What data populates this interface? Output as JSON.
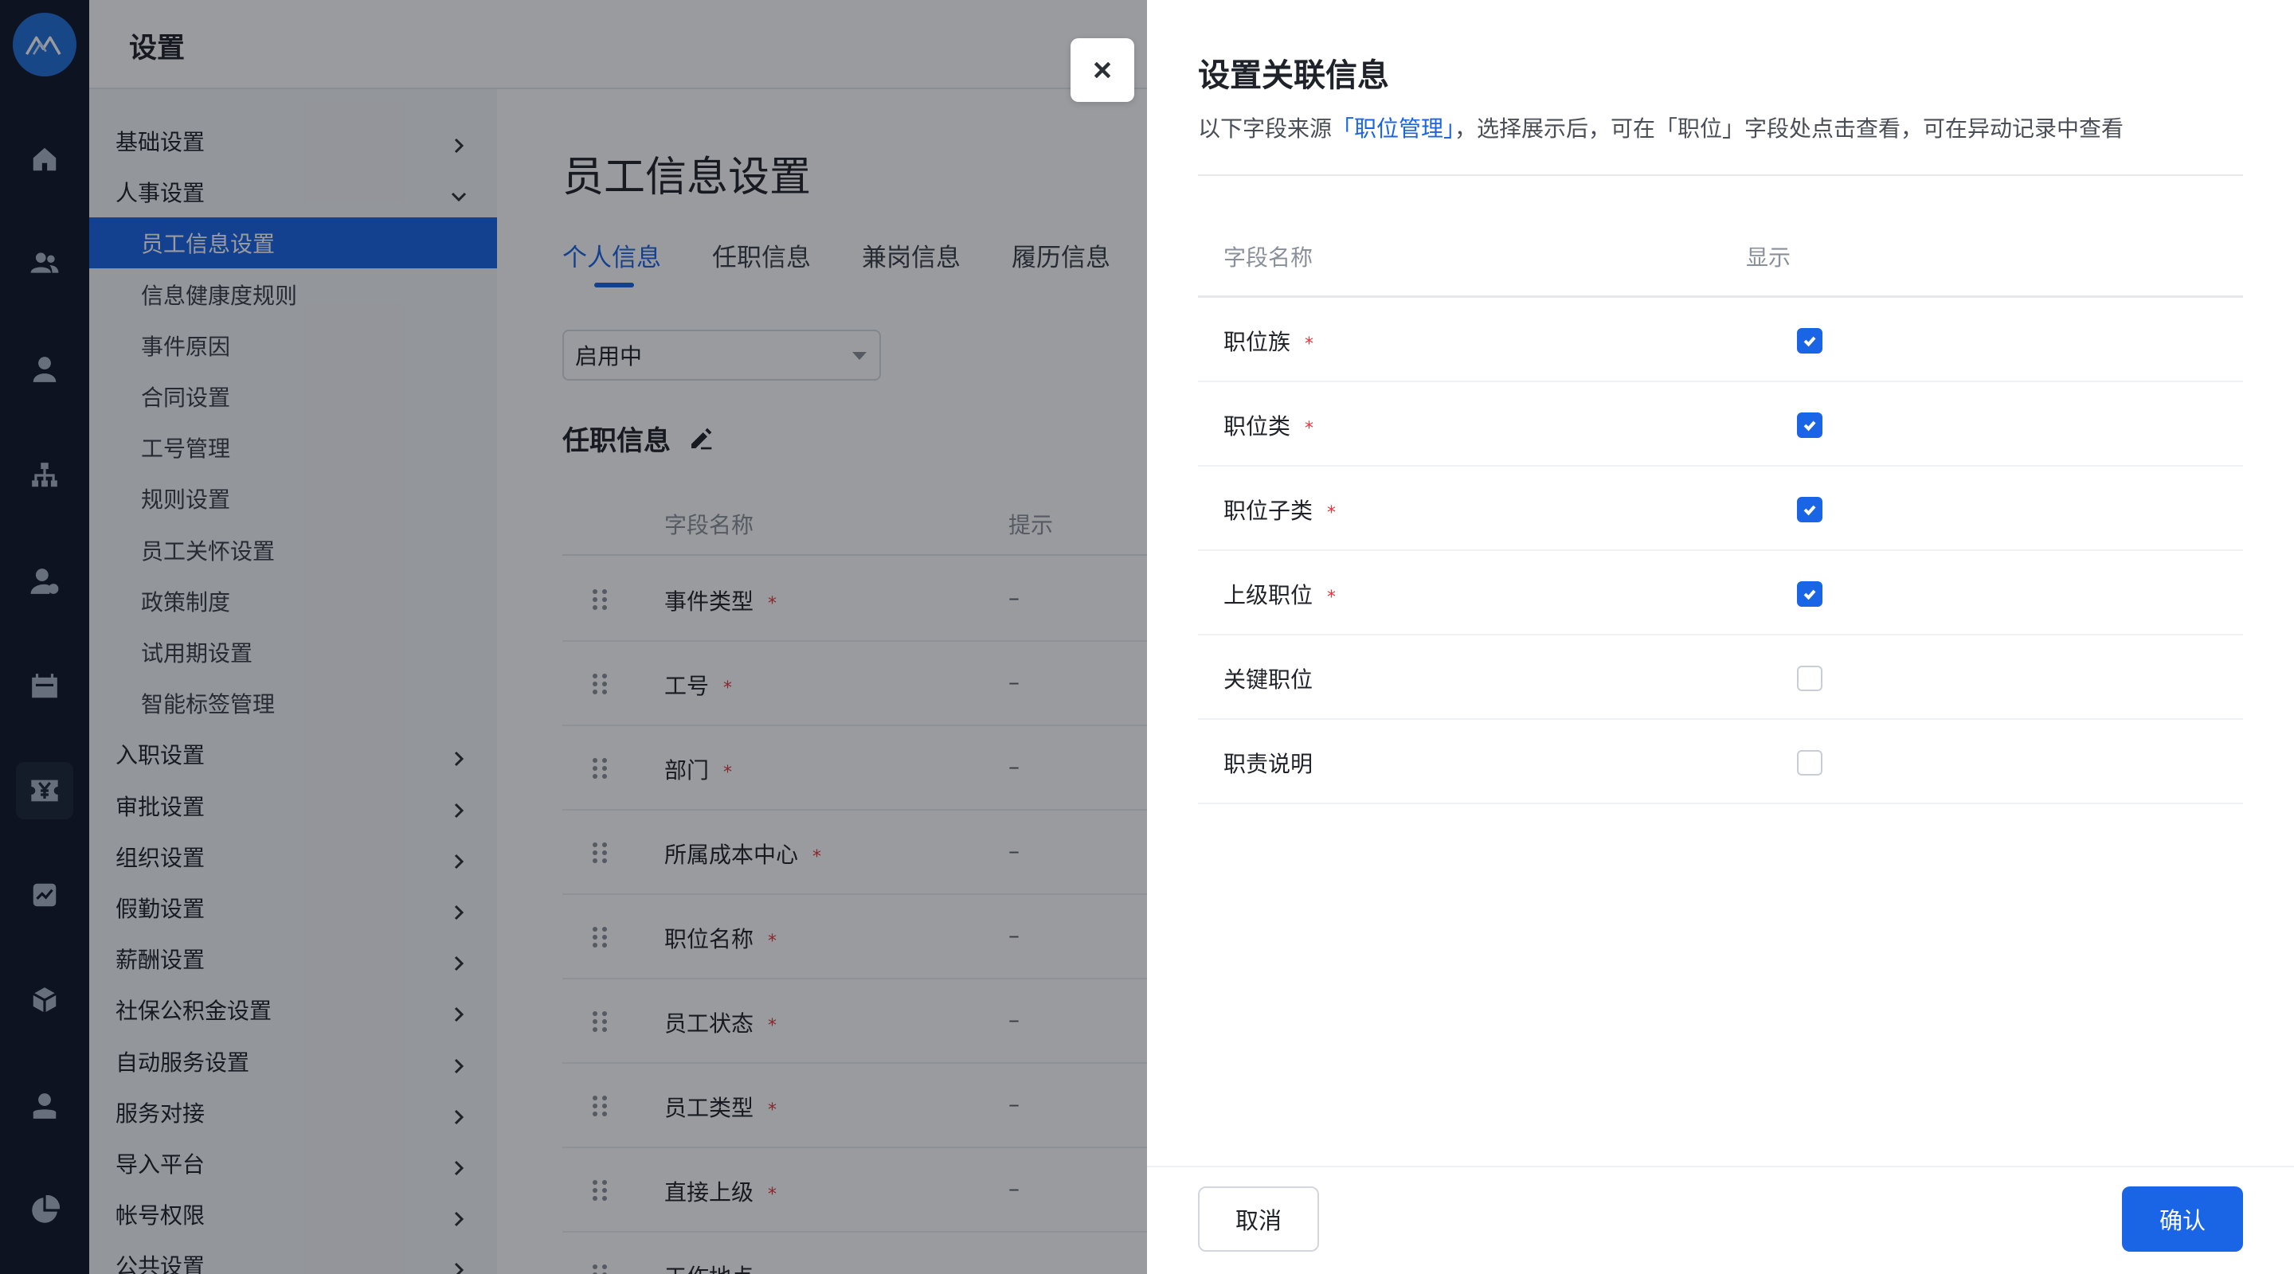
{
  "rail": {
    "logo": "app-logo",
    "icons": [
      "home-icon",
      "team-icon",
      "person-icon",
      "org-chart-icon",
      "user-settings-icon",
      "calendar-icon",
      "payroll-icon",
      "report-icon",
      "box-icon",
      "profile-icon",
      "pie-chart-icon"
    ],
    "active": "payroll-icon"
  },
  "settings": {
    "title": "设置",
    "menu": [
      {
        "label": "基础设置",
        "level": 1,
        "chevron": "right"
      },
      {
        "label": "人事设置",
        "level": 1,
        "chevron": "down"
      },
      {
        "label": "员工信息设置",
        "level": 2,
        "active": true
      },
      {
        "label": "信息健康度规则",
        "level": 2
      },
      {
        "label": "事件原因",
        "level": 2
      },
      {
        "label": "合同设置",
        "level": 2
      },
      {
        "label": "工号管理",
        "level": 2
      },
      {
        "label": "规则设置",
        "level": 2
      },
      {
        "label": "员工关怀设置",
        "level": 2
      },
      {
        "label": "政策制度",
        "level": 2
      },
      {
        "label": "试用期设置",
        "level": 2
      },
      {
        "label": "智能标签管理",
        "level": 2
      },
      {
        "label": "入职设置",
        "level": 1,
        "chevron": "right"
      },
      {
        "label": "审批设置",
        "level": 1,
        "chevron": "right"
      },
      {
        "label": "组织设置",
        "level": 1,
        "chevron": "right"
      },
      {
        "label": "假勤设置",
        "level": 1,
        "chevron": "right"
      },
      {
        "label": "薪酬设置",
        "level": 1,
        "chevron": "right"
      },
      {
        "label": "社保公积金设置",
        "level": 1,
        "chevron": "right"
      },
      {
        "label": "自动服务设置",
        "level": 1,
        "chevron": "right"
      },
      {
        "label": "服务对接",
        "level": 1,
        "chevron": "right"
      },
      {
        "label": "导入平台",
        "level": 1,
        "chevron": "right"
      },
      {
        "label": "帐号权限",
        "level": 1,
        "chevron": "right"
      },
      {
        "label": "公共设置",
        "level": 1,
        "chevron": "right"
      }
    ],
    "page_title": "员工信息设置",
    "tabs": [
      "个人信息",
      "任职信息",
      "兼岗信息",
      "履历信息"
    ],
    "active_tab": "个人信息",
    "status_select": "启用中",
    "section_title": "任职信息",
    "table": {
      "col_name": "字段名称",
      "col_hint": "提示",
      "rows": [
        {
          "name": "事件类型",
          "required": "*",
          "hint": "–"
        },
        {
          "name": "工号",
          "required": "*",
          "hint": "–"
        },
        {
          "name": "部门",
          "required": "*",
          "hint": "–"
        },
        {
          "name": "所属成本中心",
          "required": "*",
          "hint": "–"
        },
        {
          "name": "职位名称",
          "required": "*",
          "hint": "–"
        },
        {
          "name": "员工状态",
          "required": "*",
          "hint": "–"
        },
        {
          "name": "员工类型",
          "required": "*",
          "hint": "–"
        },
        {
          "name": "直接上级",
          "required": "*",
          "hint": "–"
        },
        {
          "name": "工作地点",
          "required": "",
          "hint": ""
        }
      ]
    }
  },
  "drawer": {
    "close_icon": "close-icon",
    "title": "设置关联信息",
    "desc_prefix": "以下字段来源",
    "desc_link": "「职位管理」",
    "desc_suffix": "，选择展示后，可在「职位」字段处点击查看，可在异动记录中查看",
    "col_name": "字段名称",
    "col_show": "显示",
    "rows": [
      {
        "name": "职位族",
        "required": "*",
        "checked": true
      },
      {
        "name": "职位类",
        "required": "*",
        "checked": true
      },
      {
        "name": "职位子类",
        "required": "*",
        "checked": true
      },
      {
        "name": "上级职位",
        "required": "*",
        "checked": true
      },
      {
        "name": "关键职位",
        "required": "",
        "checked": false
      },
      {
        "name": "职责说明",
        "required": "",
        "checked": false
      }
    ],
    "cancel_label": "取消",
    "confirm_label": "确认"
  },
  "colors": {
    "primary": "#1a64e6",
    "rail_bg": "#0e1626",
    "required": "#e0383e"
  }
}
